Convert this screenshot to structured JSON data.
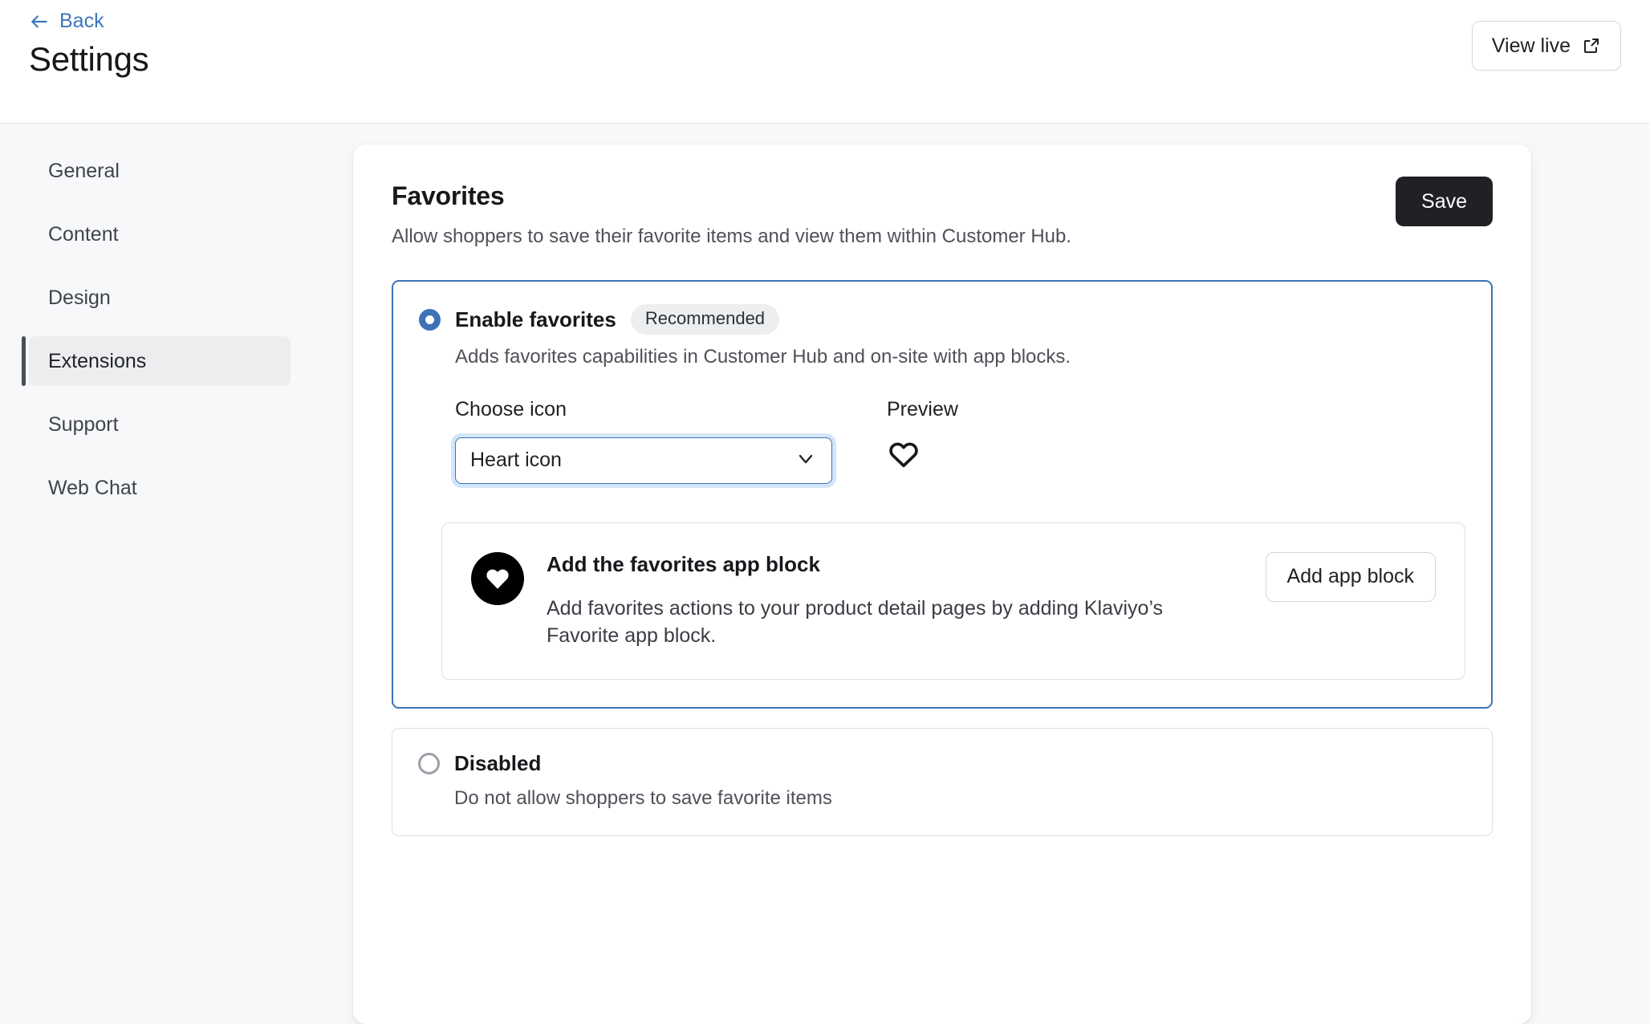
{
  "header": {
    "back_label": "Back",
    "back_icon": "arrow-left-icon",
    "title": "Settings",
    "view_live_label": "View live",
    "view_live_icon": "external-link-icon"
  },
  "sidebar": {
    "items": [
      {
        "label": "General",
        "active": false
      },
      {
        "label": "Content",
        "active": false
      },
      {
        "label": "Design",
        "active": false
      },
      {
        "label": "Extensions",
        "active": true
      },
      {
        "label": "Support",
        "active": false
      },
      {
        "label": "Web Chat",
        "active": false
      }
    ]
  },
  "main": {
    "title": "Favorites",
    "subtitle": "Allow shoppers to save their favorite items and view them within Customer Hub.",
    "save_label": "Save",
    "options": [
      {
        "id": "enable",
        "label": "Enable favorites",
        "badge": "Recommended",
        "description": "Adds favorites capabilities in Customer Hub and on-site with app blocks.",
        "selected": true
      },
      {
        "id": "disabled",
        "label": "Disabled",
        "description": "Do not allow shoppers to save favorite items",
        "selected": false
      }
    ],
    "icon_chooser": {
      "field_label": "Choose icon",
      "selected_option": "Heart icon",
      "options": [
        "Heart icon"
      ],
      "chevron_icon": "chevron-down-icon",
      "preview_label": "Preview",
      "preview_icon": "heart-outline-icon"
    },
    "app_block": {
      "icon": "heart-filled-circle-icon",
      "title": "Add the favorites app block",
      "description": "Add favorites actions to your product detail pages by adding Klaviyo’s Favorite app block.",
      "button_label": "Add app block"
    }
  },
  "colors": {
    "accent_blue": "#3c73b8",
    "link_blue": "#3c76bd",
    "page_bg": "#f7f8fa",
    "dark_button": "#1f2125",
    "badge_bg": "#eceef0",
    "focus_ring": "#d3e5f8"
  }
}
